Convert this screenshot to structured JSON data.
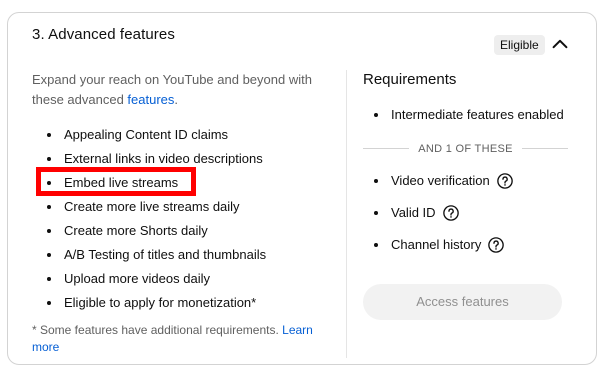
{
  "card": {
    "title": "3. Advanced features",
    "badge": "Eligible",
    "collapse_icon": "chevron-up-icon"
  },
  "left": {
    "intro_text": "Expand your reach on YouTube and beyond with these advanced ",
    "intro_link": "features",
    "intro_end": ".",
    "features": [
      "Appealing Content ID claims",
      "External links in video descriptions",
      "Embed live streams",
      "Create more live streams daily",
      "Create more Shorts daily",
      "A/B Testing of titles and thumbnails",
      "Upload more videos daily",
      "Eligible to apply for monetization*"
    ],
    "highlighted_feature_index": 2,
    "highlight_color": "#ff0000",
    "footnote_text": "* Some features have additional requirements. ",
    "footnote_link": "Learn more"
  },
  "right": {
    "title": "Requirements",
    "base_requirements": [
      "Intermediate features enabled"
    ],
    "separator": "AND 1 OF THESE",
    "optional_requirements": [
      {
        "label": "Video verification",
        "icon": "help-icon"
      },
      {
        "label": "Valid ID",
        "icon": "help-icon"
      },
      {
        "label": "Channel history",
        "icon": "help-icon"
      }
    ],
    "access_button": "Access features"
  },
  "colors": {
    "link": "#065fd4",
    "muted_text": "#606060",
    "badge_bg": "#eeeeee",
    "button_bg": "#f2f2f2",
    "button_text": "#909090"
  }
}
